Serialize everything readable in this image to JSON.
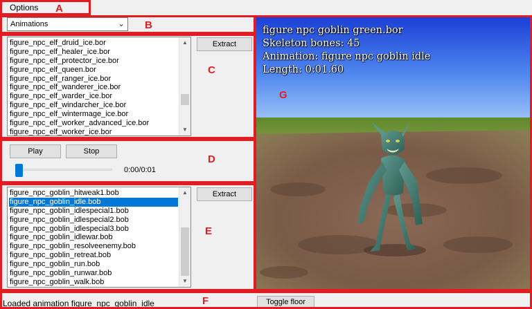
{
  "menu": {
    "options_label": "Options"
  },
  "skeleton_dropdown": {
    "selected": "Animations"
  },
  "skeleton_list": {
    "items": [
      "figure_npc_elf_druid_ice.bor",
      "figure_npc_elf_healer_ice.bor",
      "figure_npc_elf_protector_ice.bor",
      "figure_npc_elf_queen.bor",
      "figure_npc_elf_ranger_ice.bor",
      "figure_npc_elf_wanderer_ice.bor",
      "figure_npc_elf_warder_ice.bor",
      "figure_npc_elf_windarcher_ice.bor",
      "figure_npc_elf_wintermage_ice.bor",
      "figure_npc_elf_worker_advanced_ice.bor",
      "figure_npc_elf_worker_ice.bor"
    ]
  },
  "extract_top_label": "Extract",
  "playback": {
    "play_label": "Play",
    "stop_label": "Stop",
    "time": "0:00/0:01",
    "progress": 0
  },
  "animation_list": {
    "items": [
      "figure_npc_goblin_hitweak1.bob",
      "figure_npc_goblin_idle.bob",
      "figure_npc_goblin_idlespecial1.bob",
      "figure_npc_goblin_idlespecial2.bob",
      "figure_npc_goblin_idlespecial3.bob",
      "figure_npc_goblin_idlewar.bob",
      "figure_npc_goblin_resolveenemy.bob",
      "figure_npc_goblin_retreat.bob",
      "figure_npc_goblin_run.bob",
      "figure_npc_goblin_runwar.bob",
      "figure_npc_goblin_walk.bob"
    ],
    "selected_index": 1
  },
  "extract_bottom_label": "Extract",
  "viewport": {
    "line1": "figure npc goblin green.bor",
    "line2": "Skeleton bones: 45",
    "line3": "Animation: figure npc goblin idle",
    "line4": "Length: 0:01.60"
  },
  "status": {
    "text": "Loaded animation figure_npc_goblin_idle",
    "toggle_floor_label": "Toggle floor"
  },
  "annotations": {
    "a": "A",
    "b": "B",
    "c": "C",
    "d": "D",
    "e": "E",
    "f": "F",
    "g": "G"
  },
  "icons": {
    "dropdown": "chevron-down-icon",
    "scroll_up": "triangle-up-icon",
    "scroll_down": "triangle-down-icon"
  },
  "colors": {
    "annotation": "#e31b23",
    "selection": "#0078d7"
  }
}
